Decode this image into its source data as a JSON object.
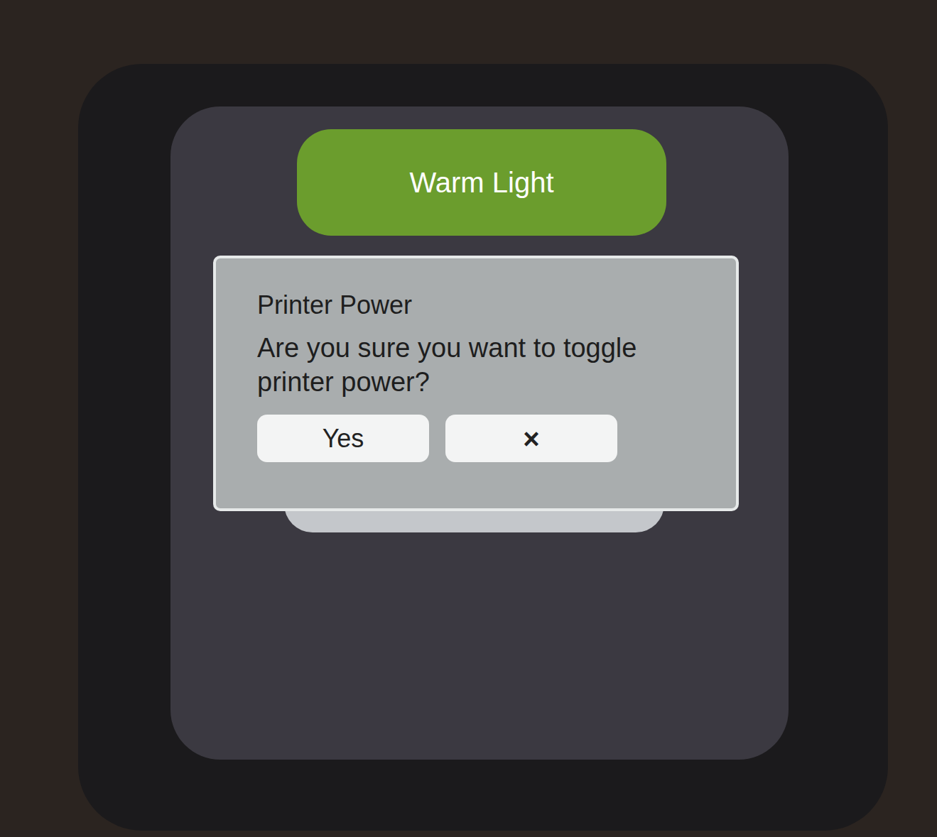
{
  "screen": {
    "buttons": [
      {
        "label": "Warm Light",
        "on": true
      }
    ]
  },
  "dialog": {
    "title": "Printer Power",
    "message": "Are you sure you want to toggle printer power?",
    "buttons": [
      "Yes",
      "×"
    ]
  }
}
